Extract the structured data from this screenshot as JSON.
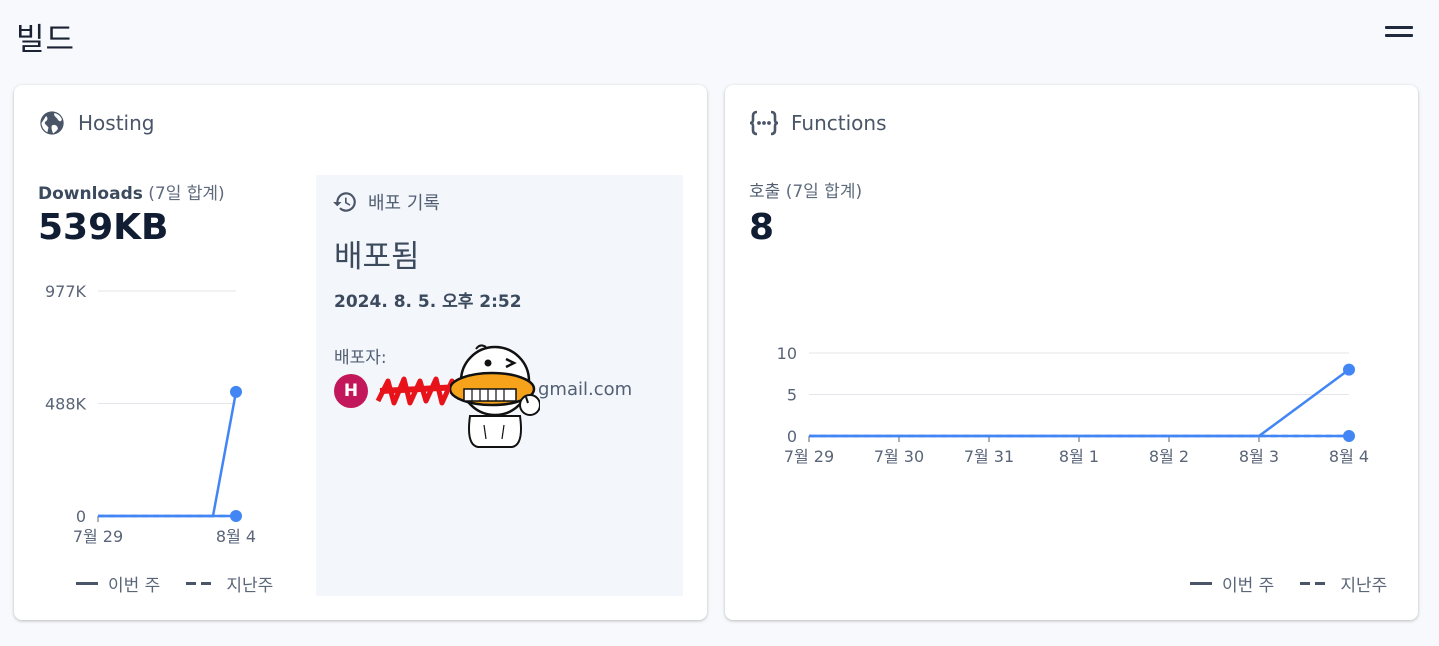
{
  "page": {
    "title": "빌드"
  },
  "hosting": {
    "title": "Hosting",
    "metric_label": "Downloads",
    "metric_sub": "(7일 합계)",
    "metric_value": "539KB",
    "deploy": {
      "heading": "배포 기록",
      "status": "배포됨",
      "time": "2024. 8. 5. 오후 2:52",
      "deployer_label": "배포자:",
      "avatar_initial": "H",
      "email": "gmail.com"
    },
    "legend": {
      "this_week": "이번 주",
      "last_week": "지난주"
    }
  },
  "functions": {
    "title": "Functions",
    "metric_label": "호출",
    "metric_sub": "(7일 합계)",
    "metric_value": "8",
    "legend": {
      "this_week": "이번 주",
      "last_week": "지난주"
    }
  },
  "colors": {
    "accent": "#4285f4",
    "avatar": "#c2185b",
    "panel": "#f3f6fb"
  },
  "chart_data": [
    {
      "type": "line",
      "title": "",
      "x_tick_labels": [
        "7월 29",
        "8월 4"
      ],
      "y_tick_labels": [
        "977K",
        "488K",
        "0"
      ],
      "ylim": [
        0,
        977000
      ],
      "grid": true,
      "legend": "bottom",
      "series": [
        {
          "name": "이번 주",
          "style": "solid",
          "color": "#4285f4",
          "values": [
            0,
            0,
            0,
            0,
            0,
            0,
            539000
          ],
          "end_marker": true
        },
        {
          "name": "지난주",
          "style": "dashed",
          "color": "#4285f4",
          "values": [
            0,
            0,
            0,
            0,
            0,
            0,
            0
          ],
          "end_marker": true
        }
      ]
    },
    {
      "type": "line",
      "title": "",
      "x_tick_labels": [
        "7월 29",
        "7월 30",
        "7월 31",
        "8월 1",
        "8월 2",
        "8월 3",
        "8월 4"
      ],
      "y_tick_labels": [
        "10",
        "5",
        "0"
      ],
      "ylim": [
        0,
        10
      ],
      "grid": true,
      "legend": "bottom-right",
      "series": [
        {
          "name": "이번 주",
          "style": "solid",
          "color": "#4285f4",
          "values": [
            0,
            0,
            0,
            0,
            0,
            0,
            8
          ],
          "end_marker": true
        },
        {
          "name": "지난주",
          "style": "dashed",
          "color": "#4285f4",
          "values": [
            0,
            0,
            0,
            0,
            0,
            0,
            0
          ],
          "end_marker": true
        }
      ]
    }
  ]
}
